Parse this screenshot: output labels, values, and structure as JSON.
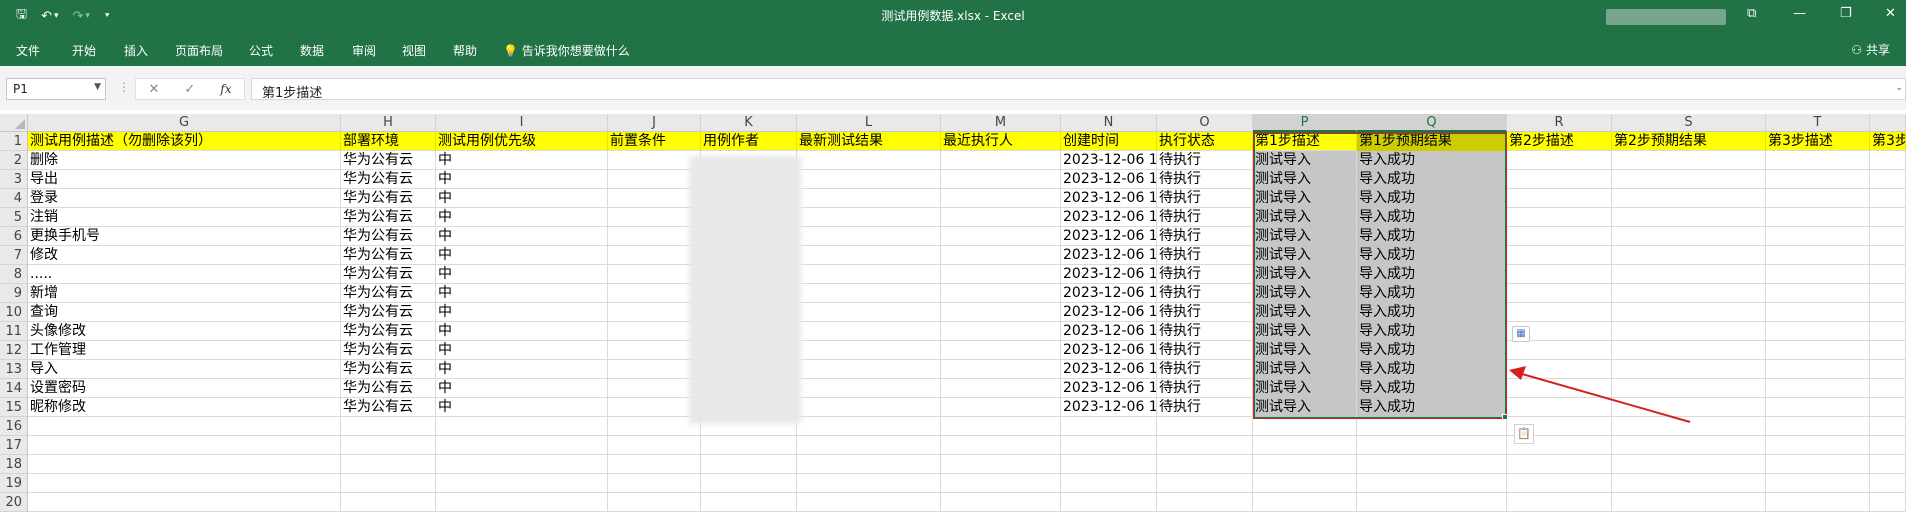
{
  "window": {
    "title": "测试用例数据.xlsx  -  Excel",
    "controls": [
      "⧉",
      "—",
      "❐",
      "✕"
    ]
  },
  "qat": {
    "save": "🖫",
    "undo": "↶",
    "undo_dd": "▾",
    "redo": "↷",
    "redo_dd": "▾",
    "customize": "⯆"
  },
  "ribbon": {
    "tabs": [
      "文件",
      "开始",
      "插入",
      "页面布局",
      "公式",
      "数据",
      "审阅",
      "视图",
      "帮助"
    ],
    "tell_me": "告诉我你想要做什么",
    "share": "共享"
  },
  "formula_bar": {
    "name_box": "P1",
    "cancel": "✕",
    "enter": "✓",
    "fx": "fx",
    "content": "第1步描述"
  },
  "columns": [
    "G",
    "H",
    "I",
    "J",
    "K",
    "L",
    "M",
    "N",
    "O",
    "P",
    "Q",
    "R",
    "S",
    "T"
  ],
  "selected_columns": [
    "P",
    "Q"
  ],
  "row_numbers": [
    "1",
    "2",
    "3",
    "4",
    "5",
    "6",
    "7",
    "8",
    "9",
    "10",
    "11",
    "12",
    "13",
    "14",
    "15",
    "16",
    "17",
    "18",
    "19",
    "20"
  ],
  "header_row": [
    "测试用例描述（勿删除该列）",
    "部署环境",
    "测试用例优先级",
    "前置条件",
    "用例作者",
    "最新测试结果",
    "最近执行人",
    "创建时间",
    "执行状态",
    "第1步描述",
    "第1步预期结果",
    "第2步描述",
    "第2步预期结果",
    "第3步描述",
    "第3步"
  ],
  "rows": [
    [
      "删除",
      "华为公有云",
      "中",
      "",
      "",
      "",
      "",
      "2023-12-06 1",
      "待执行",
      "测试导入",
      "导入成功",
      "",
      "",
      "",
      ""
    ],
    [
      "导出",
      "华为公有云",
      "中",
      "",
      "",
      "",
      "",
      "2023-12-06 1",
      "待执行",
      "测试导入",
      "导入成功",
      "",
      "",
      "",
      ""
    ],
    [
      "登录",
      "华为公有云",
      "中",
      "",
      "",
      "",
      "",
      "2023-12-06 1",
      "待执行",
      "测试导入",
      "导入成功",
      "",
      "",
      "",
      ""
    ],
    [
      "注销",
      "华为公有云",
      "中",
      "",
      "",
      "",
      "",
      "2023-12-06 1",
      "待执行",
      "测试导入",
      "导入成功",
      "",
      "",
      "",
      ""
    ],
    [
      "更换手机号",
      "华为公有云",
      "中",
      "",
      "",
      "",
      "",
      "2023-12-06 1",
      "待执行",
      "测试导入",
      "导入成功",
      "",
      "",
      "",
      ""
    ],
    [
      "修改",
      "华为公有云",
      "中",
      "",
      "",
      "",
      "",
      "2023-12-06 1",
      "待执行",
      "测试导入",
      "导入成功",
      "",
      "",
      "",
      ""
    ],
    [
      ".....",
      "华为公有云",
      "中",
      "",
      "",
      "",
      "",
      "2023-12-06 1",
      "待执行",
      "测试导入",
      "导入成功",
      "",
      "",
      "",
      ""
    ],
    [
      "新增",
      "华为公有云",
      "中",
      "",
      "",
      "",
      "",
      "2023-12-06 1",
      "待执行",
      "测试导入",
      "导入成功",
      "",
      "",
      "",
      ""
    ],
    [
      "查询",
      "华为公有云",
      "中",
      "",
      "",
      "",
      "",
      "2023-12-06 1",
      "待执行",
      "测试导入",
      "导入成功",
      "",
      "",
      "",
      ""
    ],
    [
      "头像修改",
      "华为公有云",
      "中",
      "",
      "",
      "",
      "",
      "2023-12-06 1",
      "待执行",
      "测试导入",
      "导入成功",
      "",
      "",
      "",
      ""
    ],
    [
      "工作管理",
      "华为公有云",
      "中",
      "",
      "",
      "",
      "",
      "2023-12-06 1",
      "待执行",
      "测试导入",
      "导入成功",
      "",
      "",
      "",
      ""
    ],
    [
      "导入",
      "华为公有云",
      "中",
      "",
      "",
      "",
      "",
      "2023-12-06 1",
      "待执行",
      "测试导入",
      "导入成功",
      "",
      "",
      "",
      ""
    ],
    [
      "设置密码",
      "华为公有云",
      "中",
      "",
      "",
      "",
      "",
      "2023-12-06 1",
      "待执行",
      "测试导入",
      "导入成功",
      "",
      "",
      "",
      ""
    ],
    [
      "昵称修改",
      "华为公有云",
      "中",
      "",
      "",
      "",
      "",
      "2023-12-06 1",
      "待执行",
      "测试导入",
      "导入成功",
      "",
      "",
      "",
      ""
    ]
  ],
  "colors": {
    "excel_green": "#217346",
    "header_fill": "#ffff00",
    "annotation_red": "#d42020"
  }
}
